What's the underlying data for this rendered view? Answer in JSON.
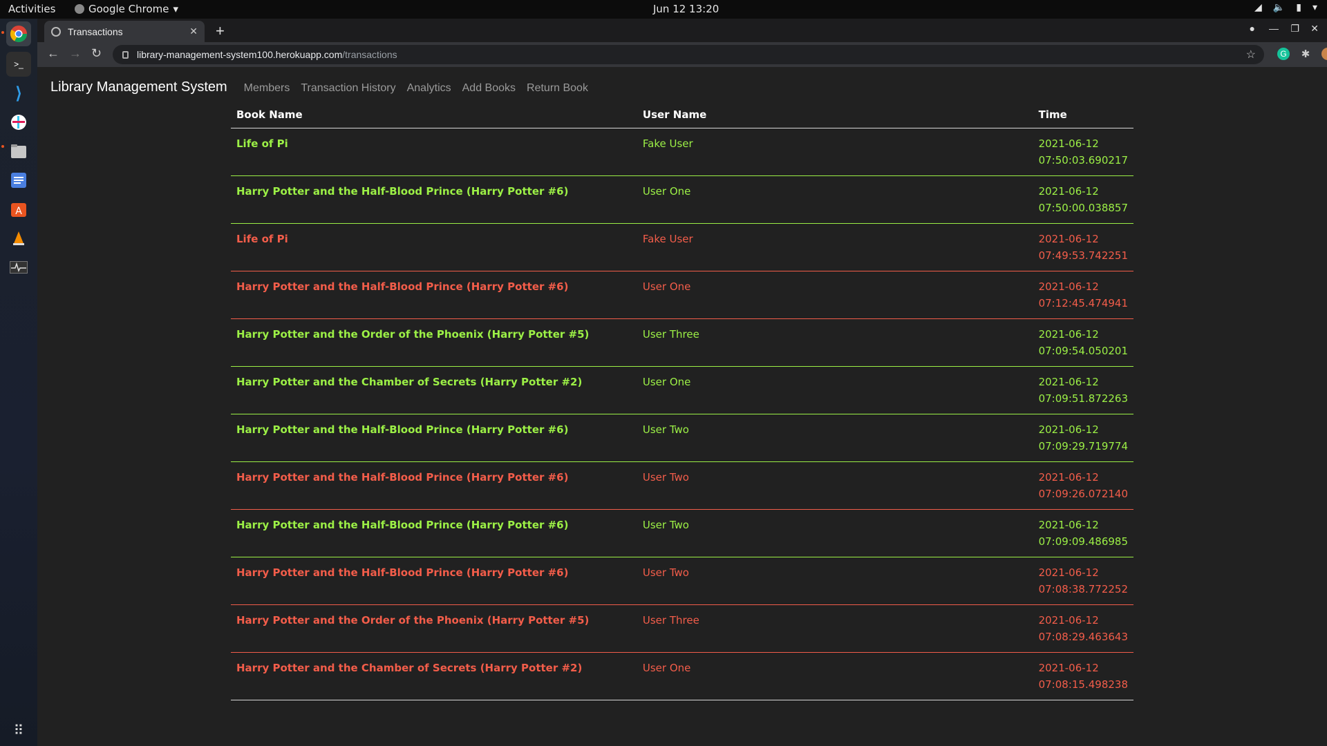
{
  "os": {
    "activities": "Activities",
    "app_menu": "Google Chrome",
    "clock": "Jun 12  13:20"
  },
  "browser": {
    "tab_title": "Transactions",
    "url_host": "library-management-system100.herokuapp.com",
    "url_path": "/transactions"
  },
  "nav": {
    "brand": "Library Management System",
    "links": [
      "Members",
      "Transaction History",
      "Analytics",
      "Add Books",
      "Return Book"
    ]
  },
  "table": {
    "headers": [
      "Book Name",
      "User Name",
      "Time"
    ],
    "rows": [
      {
        "book": "Life of Pi",
        "user": "Fake User",
        "date": "2021-06-12",
        "time": "07:50:03.690217",
        "status": "issued"
      },
      {
        "book": "Harry Potter and the Half-Blood Prince (Harry Potter #6)",
        "user": "User One",
        "date": "2021-06-12",
        "time": "07:50:00.038857",
        "status": "issued"
      },
      {
        "book": "Life of Pi",
        "user": "Fake User",
        "date": "2021-06-12",
        "time": "07:49:53.742251",
        "status": "returned"
      },
      {
        "book": "Harry Potter and the Half-Blood Prince (Harry Potter #6)",
        "user": "User One",
        "date": "2021-06-12",
        "time": "07:12:45.474941",
        "status": "returned"
      },
      {
        "book": "Harry Potter and the Order of the Phoenix (Harry Potter #5)",
        "user": "User Three",
        "date": "2021-06-12",
        "time": "07:09:54.050201",
        "status": "issued"
      },
      {
        "book": "Harry Potter and the Chamber of Secrets (Harry Potter #2)",
        "user": "User One",
        "date": "2021-06-12",
        "time": "07:09:51.872263",
        "status": "issued"
      },
      {
        "book": "Harry Potter and the Half-Blood Prince (Harry Potter #6)",
        "user": "User Two",
        "date": "2021-06-12",
        "time": "07:09:29.719774",
        "status": "issued"
      },
      {
        "book": "Harry Potter and the Half-Blood Prince (Harry Potter #6)",
        "user": "User Two",
        "date": "2021-06-12",
        "time": "07:09:26.072140",
        "status": "returned"
      },
      {
        "book": "Harry Potter and the Half-Blood Prince (Harry Potter #6)",
        "user": "User Two",
        "date": "2021-06-12",
        "time": "07:09:09.486985",
        "status": "issued"
      },
      {
        "book": "Harry Potter and the Half-Blood Prince (Harry Potter #6)",
        "user": "User Two",
        "date": "2021-06-12",
        "time": "07:08:38.772252",
        "status": "returned"
      },
      {
        "book": "Harry Potter and the Order of the Phoenix (Harry Potter #5)",
        "user": "User Three",
        "date": "2021-06-12",
        "time": "07:08:29.463643",
        "status": "returned"
      },
      {
        "book": "Harry Potter and the Chamber of Secrets (Harry Potter #2)",
        "user": "User One",
        "date": "2021-06-12",
        "time": "07:08:15.498238",
        "status": "returned"
      }
    ]
  },
  "colors": {
    "issued": "#9cf046",
    "returned": "#f35d4a",
    "page_bg": "#212121"
  }
}
